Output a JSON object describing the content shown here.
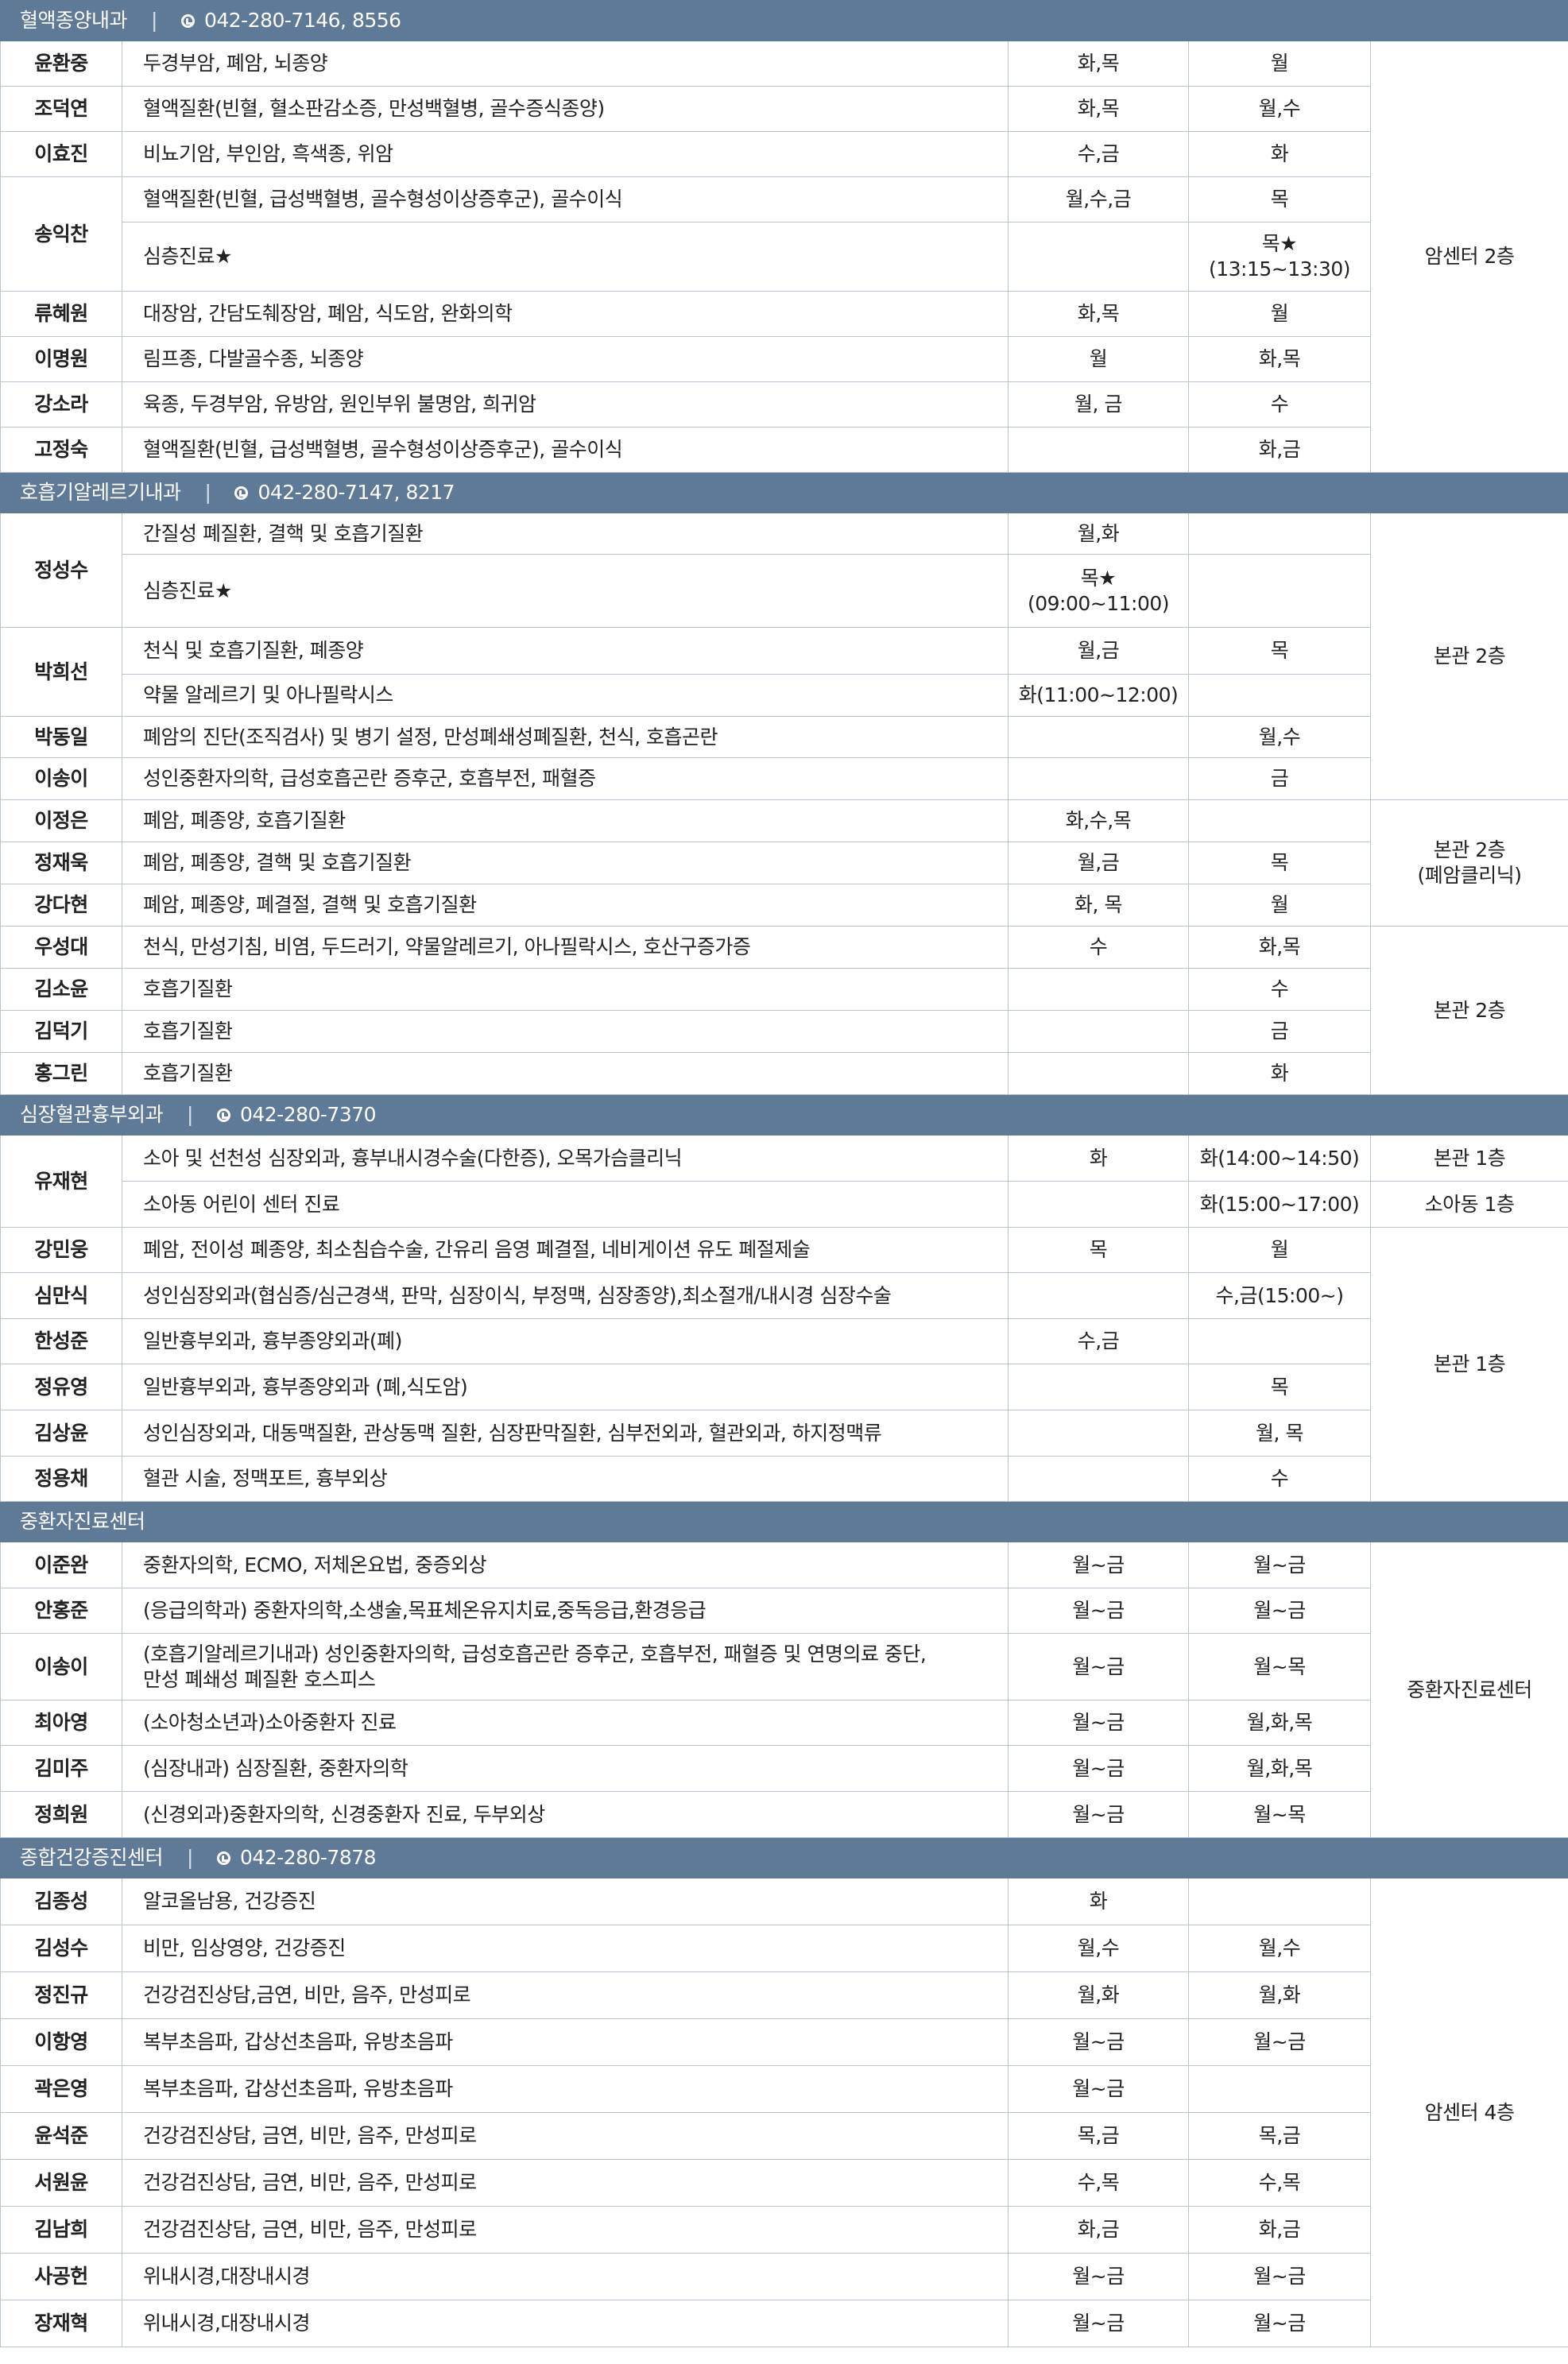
{
  "sections": {
    "s1": {
      "title": "혈액종양내과",
      "phone": "042-280-7146, 8556"
    },
    "s2": {
      "title": "호흡기알레르기내과",
      "phone": "042-280-7147, 8217"
    },
    "s3": {
      "title": "심장혈관흉부외과",
      "phone": "042-280-7370"
    },
    "s4": {
      "title": "중환자진료센터"
    },
    "s5": {
      "title": "종합건강증진센터",
      "phone": "042-280-7878"
    }
  },
  "locations": {
    "s1": "암센터 2층",
    "s2a": "본관 2층",
    "s2b_1": "본관 2층",
    "s2b_2": "(폐암클리닉)",
    "s2c": "본관 2층",
    "s3a": "본관 1층",
    "s3b": "소아동 1층",
    "s3c": "본관 1층",
    "s4": "중환자진료센터",
    "s5": "암센터 4층"
  },
  "rows": {
    "r1": {
      "name": "윤환중",
      "desc": "두경부암, 폐암, 뇌종양",
      "am": "화,목",
      "pm": "월"
    },
    "r2": {
      "name": "조덕연",
      "desc": "혈액질환(빈혈, 혈소판감소증, 만성백혈병, 골수증식종양)",
      "am": "화,목",
      "pm": "월,수"
    },
    "r3": {
      "name": "이효진",
      "desc": "비뇨기암, 부인암, 흑색종, 위암",
      "am": "수,금",
      "pm": "화"
    },
    "r4": {
      "name": "송익찬",
      "desc": "혈액질환(빈혈, 급성백혈병, 골수형성이상증후군), 골수이식",
      "am": "월,수,금",
      "pm": "목"
    },
    "r4b": {
      "desc": "심층진료★",
      "am": "",
      "pm": "목★",
      "pm2": "(13:15~13:30)"
    },
    "r5": {
      "name": "류혜원",
      "desc": "대장암, 간담도췌장암, 폐암, 식도암, 완화의학",
      "am": "화,목",
      "pm": "월"
    },
    "r6": {
      "name": "이명원",
      "desc": "림프종, 다발골수종, 뇌종양",
      "am": "월",
      "pm": "화,목"
    },
    "r7": {
      "name": "강소라",
      "desc": "육종, 두경부암, 유방암, 원인부위 불명암, 희귀암",
      "am": "월, 금",
      "pm": "수"
    },
    "r8": {
      "name": "고정숙",
      "desc": "혈액질환(빈혈, 급성백혈병, 골수형성이상증후군), 골수이식",
      "am": "",
      "pm": "화,금"
    },
    "r9": {
      "name": "정성수",
      "desc": "간질성 폐질환, 결핵 및 호흡기질환",
      "am": "월,화",
      "pm": ""
    },
    "r9b": {
      "desc": "심층진료★",
      "am": "목★",
      "am2": "(09:00~11:00)",
      "pm": ""
    },
    "r10": {
      "name": "박희선",
      "desc": "천식 및 호흡기질환, 폐종양",
      "am": "월,금",
      "pm": "목"
    },
    "r10b": {
      "desc": "약물 알레르기 및 아나필락시스",
      "am": "화(11:00~12:00)",
      "pm": ""
    },
    "r11": {
      "name": "박동일",
      "desc": "폐암의 진단(조직검사) 및 병기 설정, 만성폐쇄성폐질환, 천식, 호흡곤란",
      "am": "",
      "pm": "월,수"
    },
    "r12": {
      "name": "이송이",
      "desc": "성인중환자의학, 급성호흡곤란 증후군, 호흡부전, 패혈증",
      "am": "",
      "pm": "금"
    },
    "r13": {
      "name": "이정은",
      "desc": "폐암, 폐종양, 호흡기질환",
      "am": "화,수,목",
      "pm": ""
    },
    "r14": {
      "name": "정재욱",
      "desc": "폐암, 폐종양, 결핵 및 호흡기질환",
      "am": "월,금",
      "pm": "목"
    },
    "r15": {
      "name": "강다현",
      "desc": "폐암, 폐종양, 폐결절, 결핵 및 호흡기질환",
      "am": "화, 목",
      "pm": "월"
    },
    "r16": {
      "name": "우성대",
      "desc": "천식, 만성기침, 비염, 두드러기, 약물알레르기, 아나필락시스, 호산구증가증",
      "am": "수",
      "pm": "화,목"
    },
    "r17": {
      "name": "김소윤",
      "desc": "호흡기질환",
      "am": "",
      "pm": "수"
    },
    "r18": {
      "name": "김덕기",
      "desc": "호흡기질환",
      "am": "",
      "pm": "금"
    },
    "r19": {
      "name": "홍그린",
      "desc": "호흡기질환",
      "am": "",
      "pm": "화"
    },
    "r20": {
      "name": "유재현",
      "desc": "소아 및 선천성 심장외과, 흉부내시경수술(다한증), 오목가슴클리닉",
      "am": "화",
      "pm": "화(14:00~14:50)"
    },
    "r20b": {
      "desc": "소아동 어린이 센터 진료",
      "am": "",
      "pm": "화(15:00~17:00)"
    },
    "r21": {
      "name": "강민웅",
      "desc": "폐암, 전이성 폐종양, 최소침습수술, 간유리 음영 폐결절, 네비게이션 유도 폐절제술",
      "am": "목",
      "pm": "월"
    },
    "r22": {
      "name": "심만식",
      "desc": "성인심장외과(협심증/심근경색, 판막, 심장이식, 부정맥, 심장종양),최소절개/내시경 심장수술",
      "am": "",
      "pm": "수,금(15:00~)"
    },
    "r23": {
      "name": "한성준",
      "desc": "일반흉부외과, 흉부종양외과(폐)",
      "am": "수,금",
      "pm": ""
    },
    "r24": {
      "name": "정유영",
      "desc": "일반흉부외과, 흉부종양외과 (폐,식도암)",
      "am": "",
      "pm": "목"
    },
    "r25": {
      "name": "김상윤",
      "desc": "성인심장외과, 대동맥질환, 관상동맥 질환, 심장판막질환, 심부전외과, 혈관외과, 하지정맥류",
      "am": "",
      "pm": "월, 목"
    },
    "r26": {
      "name": "정용채",
      "desc": "혈관 시술, 정맥포트, 흉부외상",
      "am": "",
      "pm": "수"
    },
    "r27": {
      "name": "이준완",
      "desc": "중환자의학, ECMO, 저체온요법, 중증외상",
      "am": "월~금",
      "pm": "월~금"
    },
    "r28": {
      "name": "안홍준",
      "desc": "(응급의학과) 중환자의학,소생술,목표체온유지치료,중독응급,환경응급",
      "am": "월~금",
      "pm": "월~금"
    },
    "r29": {
      "name": "이송이",
      "desc": "(호흡기알레르기내과) 성인중환자의학, 급성호흡곤란 증후군, 호흡부전, 패혈증 및 연명의료 중단,",
      "desc2": "만성 폐쇄성 폐질환 호스피스",
      "am": "월~금",
      "pm": "월~목"
    },
    "r30": {
      "name": "최아영",
      "desc": "(소아청소년과)소아중환자 진료",
      "am": "월~금",
      "pm": "월,화,목"
    },
    "r31": {
      "name": "김미주",
      "desc": "(심장내과) 심장질환, 중환자의학",
      "am": "월~금",
      "pm": "월,화,목"
    },
    "r32": {
      "name": "정희원",
      "desc": "(신경외과)중환자의학, 신경중환자 진료, 두부외상",
      "am": "월~금",
      "pm": "월~목"
    },
    "r33": {
      "name": "김종성",
      "desc": "알코올남용, 건강증진",
      "am": "화",
      "pm": ""
    },
    "r34": {
      "name": "김성수",
      "desc": "비만, 임상영양, 건강증진",
      "am": "월,수",
      "pm": "월,수"
    },
    "r35": {
      "name": "정진규",
      "desc": "건강검진상담,금연, 비만, 음주, 만성피로",
      "am": "월,화",
      "pm": "월,화"
    },
    "r36": {
      "name": "이항영",
      "desc": "복부초음파, 갑상선초음파, 유방초음파",
      "am": "월~금",
      "pm": "월~금"
    },
    "r37": {
      "name": "곽은영",
      "desc": "복부초음파, 갑상선초음파, 유방초음파",
      "am": "월~금",
      "pm": ""
    },
    "r38": {
      "name": "윤석준",
      "desc": "건강검진상담, 금연, 비만, 음주, 만성피로",
      "am": "목,금",
      "pm": "목,금"
    },
    "r39": {
      "name": "서원윤",
      "desc": "건강검진상담, 금연, 비만, 음주, 만성피로",
      "am": "수,목",
      "pm": "수,목"
    },
    "r40": {
      "name": "김남희",
      "desc": "건강검진상담, 금연, 비만, 음주, 만성피로",
      "am": "화,금",
      "pm": "화,금"
    },
    "r41": {
      "name": "사공헌",
      "desc": "위내시경,대장내시경",
      "am": "월~금",
      "pm": "월~금"
    },
    "r42": {
      "name": "장재혁",
      "desc": "위내시경,대장내시경",
      "am": "월~금",
      "pm": "월~금"
    }
  }
}
